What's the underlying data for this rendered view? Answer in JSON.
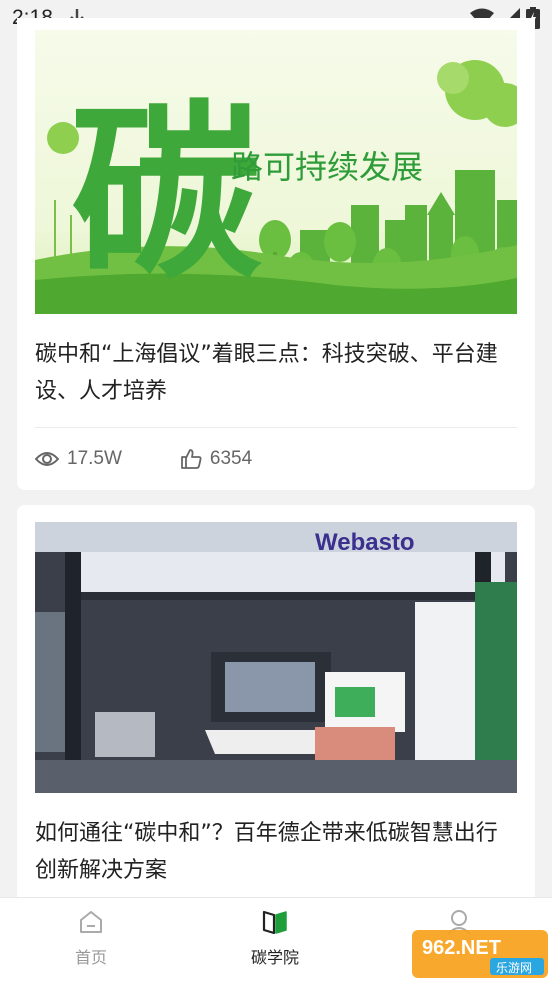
{
  "status_bar": {
    "time": "2:18"
  },
  "articles": [
    {
      "image_text": "碳",
      "image_slogan": "路可持续发展",
      "title": "碳中和“上海倡议”着眼三点：科技突破、平台建设、人才培养",
      "views": "17.5W",
      "likes": "6354"
    },
    {
      "image_brand": "Webasto",
      "title": "如何通往“碳中和”？百年德企带来低碳智慧出行创新解决方案"
    }
  ],
  "nav": {
    "items": [
      {
        "label": "首页",
        "icon": "home-icon"
      },
      {
        "label": "碳学院",
        "icon": "book-icon"
      },
      {
        "label": "",
        "icon": "user-icon"
      }
    ],
    "active_index": 1
  },
  "watermark": {
    "text": "962.NET",
    "subtext": "乐游网"
  },
  "colors": {
    "accent_green": "#1e9e3a",
    "text_primary": "#222222",
    "text_secondary": "#666666"
  }
}
